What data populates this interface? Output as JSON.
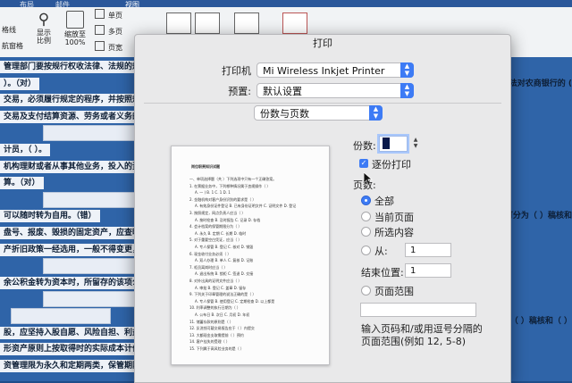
{
  "ribbon": {
    "tabs": [
      "布局",
      "邮件",
      "视图"
    ],
    "buttons": {
      "show_ratio": "显示\n比例",
      "zoom_to": "缩放至\n100%"
    },
    "page_options": [
      "单页",
      "多页",
      "页宽"
    ],
    "left_items": [
      "格线",
      "航窗格"
    ]
  },
  "document": {
    "left_lines": [
      "管理部门要按规行权收法律、法规的规定，依",
      "）。（对）",
      "交易，必须履行规定的程序，并按照规定股",
      "交易及支付结算资源、劳务或者义务的份款。对",
      "",
      "计员，（ ）。",
      "机构理财或者从事其他业务，投入的资金不",
      "算。（对）",
      "",
      "可以随时转为自用。（错）",
      "盘号、报废、毁损的固定资产，应查明原因",
      "产折旧政策一经选用，一般不得变更，确需",
      "",
      "余公积金转为资本时，所留存的该项公积金",
      "",
      "",
      "股，应坚持入股自愿、风险自担、利益共享",
      "形资产原则上按取得时的实际成本计价。（",
      "资管理限为永久和定期两类，保管期限"
    ],
    "right_lines": [
      "的依法对农商银行的 (",
      "，可分为（  ）稿核和",
      "（  ）稿核和（  ）"
    ]
  },
  "dialog": {
    "title": "打印",
    "printer_label": "打印机",
    "printer_value": "Mi Wireless Inkjet Printer",
    "presets_label": "预置:",
    "presets_value": "默认设置",
    "section_value": "份数与页数",
    "copies_label": "份数:",
    "copies_value": "1",
    "collate_label": "逐份打印",
    "pages_label": "页数:",
    "radio_all": "全部",
    "radio_current": "当前页面",
    "radio_selection": "所选内容",
    "radio_from": "从:",
    "from_value": "1",
    "to_label": "结束位置:",
    "to_value": "1",
    "radio_range": "页面范围",
    "range_value": "",
    "hint": "输入页码和/或用逗号分隔的\n页面范围(例如 12, 5-8)"
  },
  "preview": {
    "title": "岗位职责知识试题",
    "lines": [
      "一、单项选择题（共  ）下列选项中只有一个正确答案。",
      "1. 在票据业务中，下列哪种情况属于违规操作（  ）",
      "A. 一 )    B. 1    C. 1    D. 1",
      "2. 金融机构对客户身份识别的要求是（  ）",
      "A. 有效身份证件登记   B. 已有身份证明文件   C. 证明文件   D. 登记",
      "3. 按照规定，网点负责人应当（  ）",
      "A. 按时检查   B. 及时报告   C. 记录   D. 存档",
      "4. 会计档案的保管期限分为（  ）",
      "A. 永久   B. 定期   C. 长期   D. 临时",
      "5. 对于重要空白凭证，应当（  ）",
      "A. 专人保管   B. 登记   C. 核对   D. 销毁",
      "6. 现金收付业务必须（  ）",
      "A. 双人办理   B. 单人   C. 复核   D. 记账",
      "7. 柜员离岗时应当（  ）",
      "A. 退出系统   B. 锁柜   C. 签退   D. 交接",
      "8. 对外出具的证明文件应当（  ）",
      "A. 审批   B. 登记   C. 盖章   D. 留存",
      "9. 下列关于印章管理的说法正确的是（  ）",
      "A. 专人保管   B. 使用登记   C. 定期检查   D. 以上都是",
      "10. 利率调整的执行日期为（  ）",
      "A. 公布日   B. 次日   C. 月初   D. 年初",
      "11. 储蓄存款的原则是（  ）",
      "12. 反洗钱可疑交易报告应于（  ）内提交",
      "13. 大额现金支取需提前（  ）预约",
      "14. 客户挂失的受理（  ）",
      "15. 下列属于高风险业务的是（  ）"
    ]
  }
}
